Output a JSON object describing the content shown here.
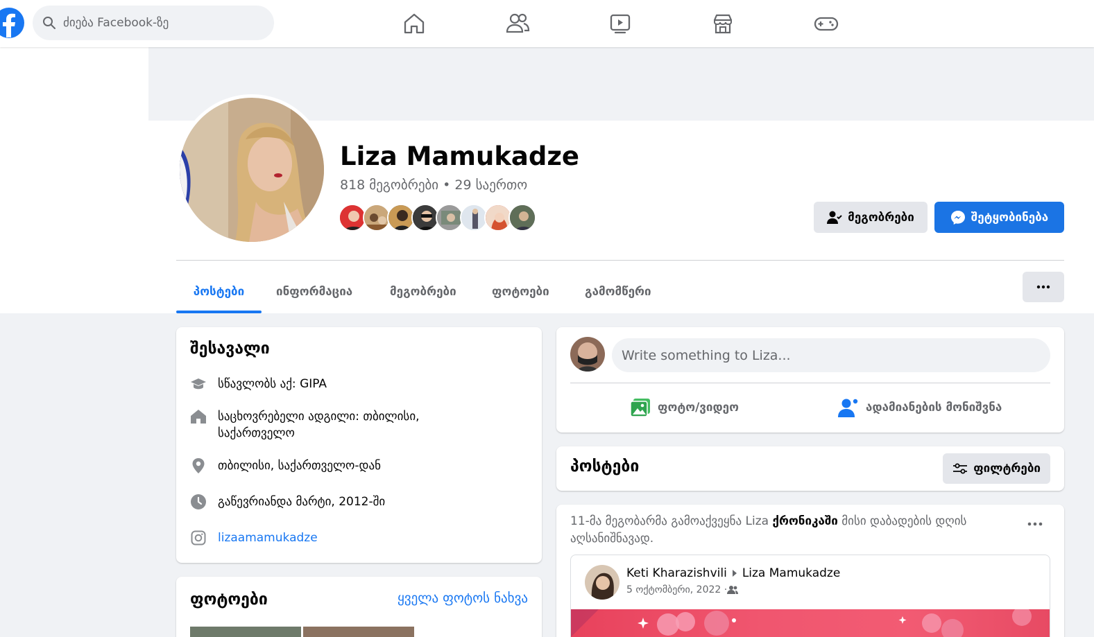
{
  "colors": {
    "brand": "#1877f2",
    "primary_button": "#1b74e4",
    "secondary_button": "#e4e6eb",
    "page_bg": "#f0f2f5",
    "text_secondary": "#65676b"
  },
  "topbar": {
    "search_placeholder": "ძიება Facebook-ზე",
    "nav_icons": [
      "home-icon",
      "friends-icon",
      "watch-icon",
      "marketplace-icon",
      "gaming-icon"
    ]
  },
  "profile": {
    "name": "Liza Mamukadze",
    "friends_summary": "818 მეგობრები • 29 საერთო",
    "friends_button": "მეგობრები",
    "message_button": "შეტყობინება"
  },
  "tabs": [
    {
      "label": "პოსტები",
      "active": true
    },
    {
      "label": "ინფორმაცია",
      "active": false
    },
    {
      "label": "მეგობრები",
      "active": false
    },
    {
      "label": "ფოტოები",
      "active": false
    },
    {
      "label": "გამომწერი",
      "active": false
    }
  ],
  "intro": {
    "title": "შესავალი",
    "studies_prefix": "სწავლობს აქ: ",
    "studies_value": "GIPA",
    "lives_prefix": "საცხოვრებელი ადგილი: ",
    "lives_value": "თბილისი,",
    "lives_value_line2": "საქართველო",
    "from": "თბილისი, საქართველო-დან",
    "joined": "გაწევრიანდა მარტი, 2012-ში",
    "instagram": "lizaamamukadze"
  },
  "photos": {
    "title": "ფოტოები",
    "see_all": "ყველა ფოტოს ნახვა"
  },
  "composer": {
    "placeholder": "Write something to Liza...",
    "photo_video": "ფოტო/ვიდეო",
    "tag_people": "ადამიანების მონიშვნა"
  },
  "posts_section": {
    "title": "პოსტები",
    "filters": "ფილტრები"
  },
  "post": {
    "header_prefix": "11-მა მეგობარმა გამოაქვეყნა Liza ",
    "header_bold": "ქრონიკაში",
    "header_suffix": " მისი დაბადების დღის აღსანიშნავად.",
    "inner_author": "Keti Kharazishvili",
    "inner_target": "Liza Mamukadze",
    "inner_date": "5 ოქტომბერი, 2022 · "
  }
}
